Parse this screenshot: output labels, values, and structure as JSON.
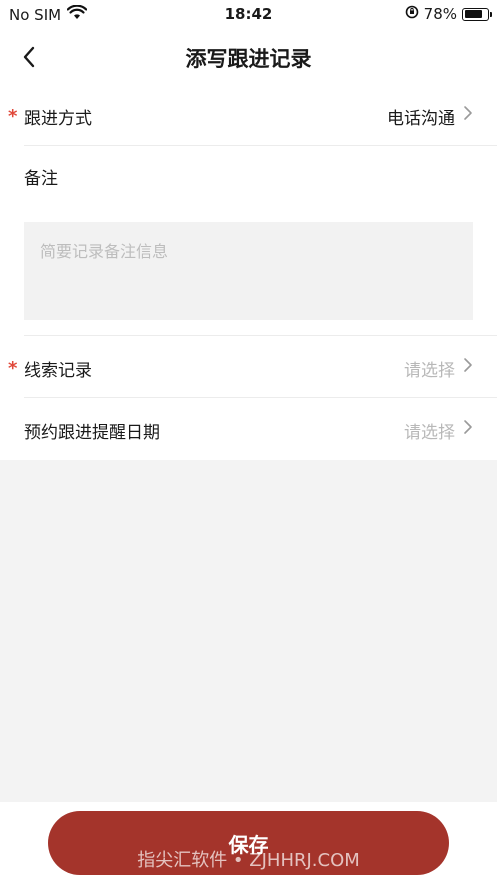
{
  "status_bar": {
    "carrier": "No SIM",
    "time": "18:42",
    "battery": "78%",
    "battery_level": 0.78
  },
  "nav": {
    "title": "添写跟进记录"
  },
  "form": {
    "follow_method": {
      "label": "跟进方式",
      "value": "电话沟通",
      "required_mark": "*"
    },
    "note": {
      "label": "备注",
      "placeholder": "简要记录备注信息"
    },
    "lead_record": {
      "label": "线索记录",
      "value": "请选择",
      "required_mark": "*"
    },
    "reminder_date": {
      "label": "预约跟进提醒日期",
      "value": "请选择"
    }
  },
  "footer": {
    "save_label": "保存",
    "watermark": "指尖汇软件 • ZJHHRJ.COM"
  },
  "colors": {
    "accent": "#a4342b",
    "required": "#e0483a",
    "placeholder": "#b8b8b8"
  }
}
